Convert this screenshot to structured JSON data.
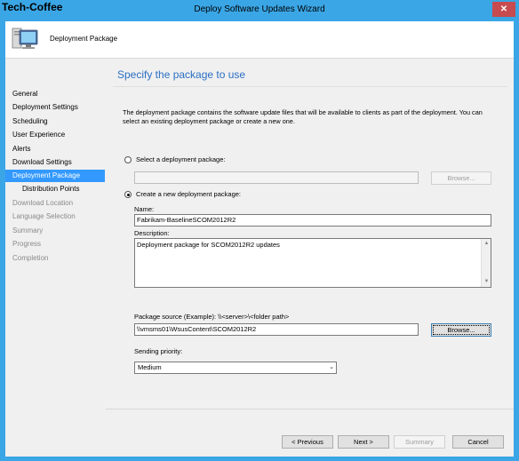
{
  "watermark": "Tech-Coffee",
  "window": {
    "title": "Deploy Software Updates Wizard",
    "close_glyph": "✕"
  },
  "header": {
    "title": "Deployment Package",
    "icon": "computer-monitor-icon"
  },
  "nav": {
    "items": [
      {
        "label": "General",
        "state": "normal"
      },
      {
        "label": "Deployment Settings",
        "state": "normal"
      },
      {
        "label": "Scheduling",
        "state": "normal"
      },
      {
        "label": "User Experience",
        "state": "normal"
      },
      {
        "label": "Alerts",
        "state": "normal"
      },
      {
        "label": "Download Settings",
        "state": "normal"
      },
      {
        "label": "Deployment Package",
        "state": "active"
      },
      {
        "label": "Distribution Points",
        "state": "normal"
      },
      {
        "label": "Download Location",
        "state": "disabled"
      },
      {
        "label": "Language Selection",
        "state": "disabled"
      },
      {
        "label": "Summary",
        "state": "disabled"
      },
      {
        "label": "Progress",
        "state": "disabled"
      },
      {
        "label": "Completion",
        "state": "disabled"
      }
    ]
  },
  "main": {
    "page_title": "Specify the package to use",
    "description": "The deployment package contains the software update files that will be available to clients as part of the deployment. You can select an existing deployment package or create a new one.",
    "select_existing_label": "Select a deployment package:",
    "select_existing_value": "",
    "browse_existing_label": "Browse...",
    "create_new_label": "Create a new deployment package:",
    "name_label": "Name:",
    "name_value": "Fabrikam-BaselineSCOM2012R2",
    "description_label": "Description:",
    "description_value": "Deployment package for SCOM2012R2 updates",
    "source_label": "Package source (Example): \\\\<server>\\<folder path>",
    "source_value": "\\\\vmsms01\\WsusContent\\SCOM2012R2",
    "browse_source_label": "Browse...",
    "priority_label": "Sending priority:",
    "priority_value": "Medium",
    "selected_option": "create-new"
  },
  "footer": {
    "previous_label": "< Previous",
    "next_label": "Next >",
    "summary_label": "Summary",
    "cancel_label": "Cancel"
  },
  "colors": {
    "titlebar": "#3aa6e6",
    "active_nav": "#3399ff",
    "page_title": "#2a6fc4",
    "close": "#c74b50"
  }
}
